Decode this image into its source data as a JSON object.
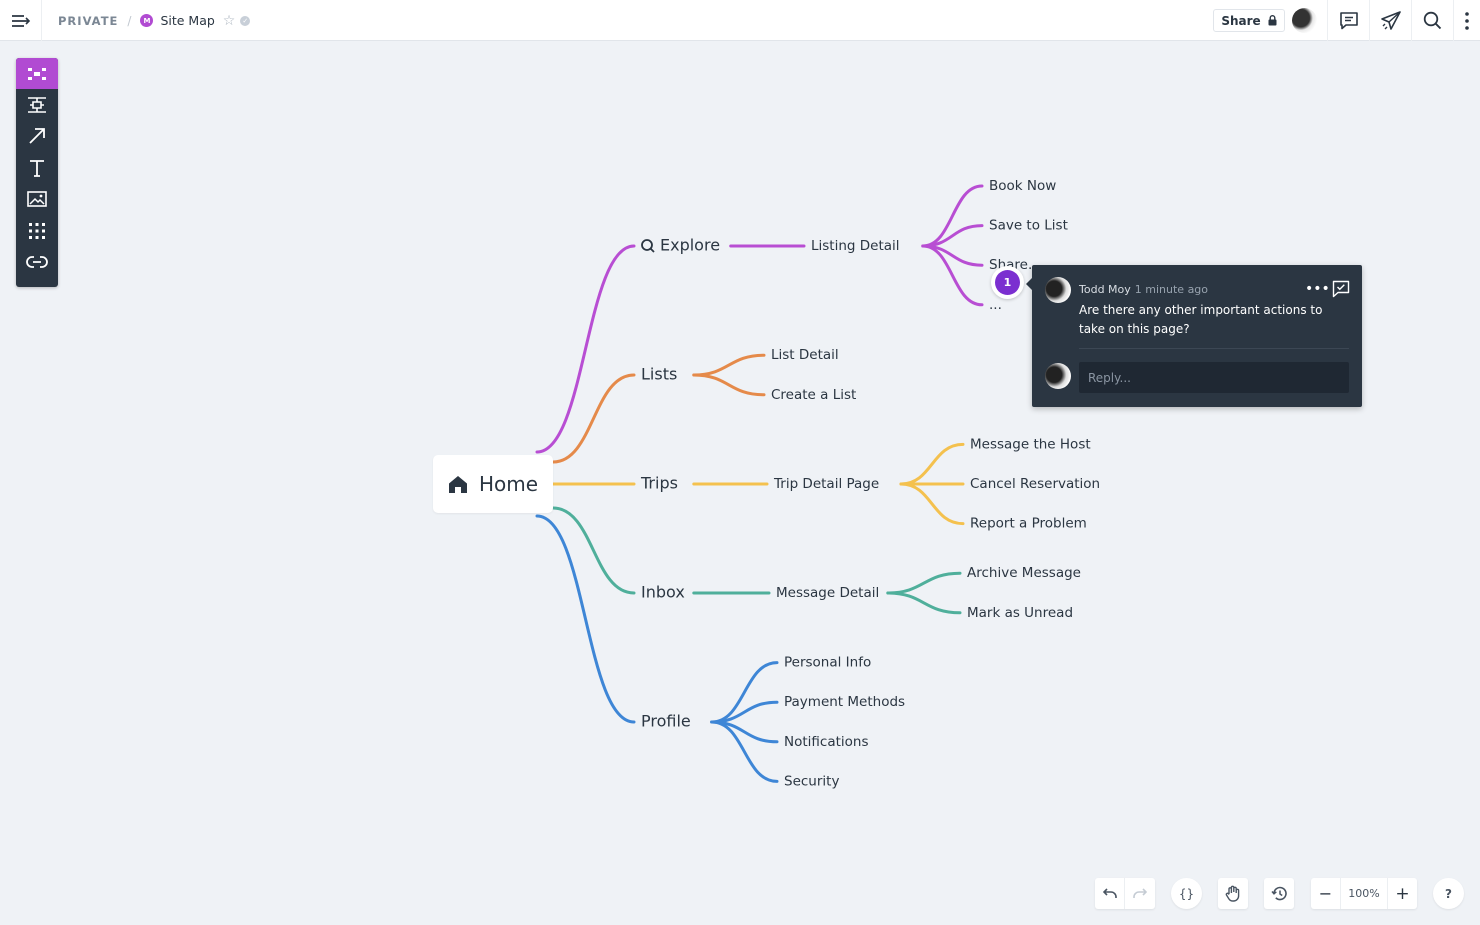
{
  "header": {
    "visibility": "PRIVATE",
    "separator": "/",
    "doc_badge": "M",
    "doc_title": "Site Map",
    "share_label": "Share",
    "icons": [
      "menu-collapse-icon",
      "star-icon",
      "verified-icon",
      "lock-icon",
      "comments-icon",
      "present-icon",
      "search-icon",
      "more-vertical-icon"
    ]
  },
  "toolbar": {
    "tools": [
      {
        "name": "mindmap-tool",
        "active": true
      },
      {
        "name": "flowchart-tool",
        "active": false
      },
      {
        "name": "arrow-tool",
        "active": false
      },
      {
        "name": "text-tool",
        "active": false
      },
      {
        "name": "image-tool",
        "active": false
      },
      {
        "name": "widgets-tool",
        "active": false
      },
      {
        "name": "link-tool",
        "active": false
      }
    ]
  },
  "mindmap": {
    "root": "Home",
    "branches": [
      {
        "label": "Explore",
        "icon": "search-icon",
        "color": "#b84ed3",
        "child": "Listing Detail",
        "leaves": [
          "Book Now",
          "Save to List",
          "Share...",
          "..."
        ]
      },
      {
        "label": "Lists",
        "color": "#e58a4a",
        "child": null,
        "leaves": [
          "List Detail",
          "Create a List"
        ]
      },
      {
        "label": "Trips",
        "color": "#f4c14e",
        "child": "Trip Detail Page",
        "leaves": [
          "Message the Host",
          "Cancel Reservation",
          "Report a Problem"
        ]
      },
      {
        "label": "Inbox",
        "color": "#4faf9b",
        "child": "Message Detail",
        "leaves": [
          "Archive Message",
          "Mark as Unread"
        ]
      },
      {
        "label": "Profile",
        "color": "#3e86d6",
        "child": null,
        "leaves": [
          "Personal Info",
          "Payment Methods",
          "Notifications",
          "Security"
        ]
      }
    ]
  },
  "comment": {
    "pin_number": "1",
    "author": "Todd Moy",
    "time": "1 minute ago",
    "text": "Are there any other important actions to take on this page?",
    "reply_placeholder": "Reply..."
  },
  "bottom_controls": {
    "zoom_level": "100%",
    "code_label": "{}",
    "help_label": "?",
    "zoom_out_label": "−",
    "zoom_in_label": "+"
  },
  "colors": {
    "accent": "#b14bd2",
    "pin": "#7b2fd0",
    "dark_panel": "#2b3642",
    "canvas": "#eff2f6"
  }
}
